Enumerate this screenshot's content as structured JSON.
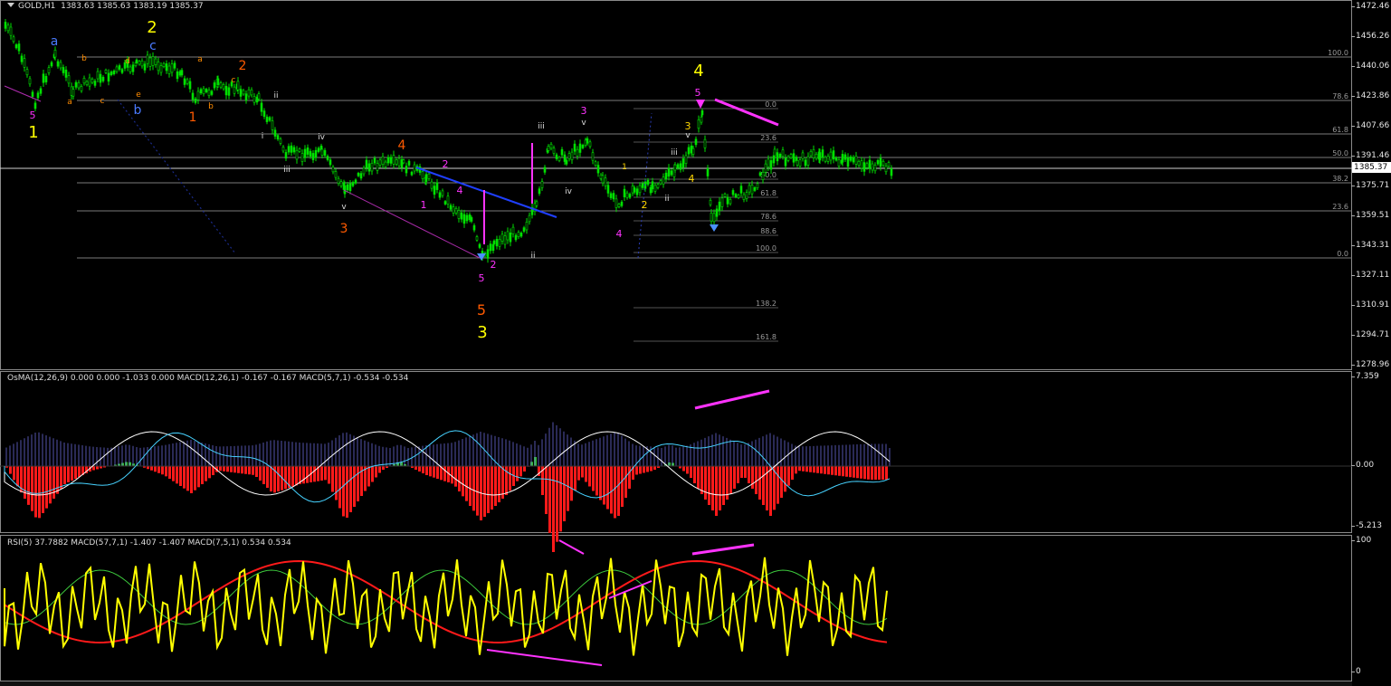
{
  "header": {
    "symbol": "GOLD,H1",
    "ohlc": "1383.63 1385.63 1383.19 1385.37"
  },
  "current_price": "1385.37",
  "price_axis": [
    "1472.46",
    "1456.26",
    "1440.06",
    "1423.86",
    "1407.66",
    "1391.46",
    "1375.71",
    "1359.51",
    "1343.31",
    "1327.11",
    "1310.91",
    "1294.71",
    "1278.96"
  ],
  "osma_panel": {
    "label": "OsMA(12,26,9) 0.000 0.000 -1.033 0.000  MACD(12,26,1) -0.167 -0.167  MACD(5,7,1) -0.534 -0.534",
    "axis": [
      "7.359",
      "0.00",
      "-5.213"
    ]
  },
  "rsi_panel": {
    "label": "RSI(5) 37.7882  MACD(57,7,1) -1.407 -1.407  MACD(7,5,1) 0.534 0.534",
    "axis": [
      "100",
      "0"
    ]
  },
  "fib_left": [
    "100.0",
    "78.6",
    "61.8",
    "50.0",
    "38.2",
    "23.6",
    "0.0"
  ],
  "fib_right": [
    "0.0",
    "23.6",
    "50.0",
    "61.8",
    "78.6",
    "88.6",
    "100.0",
    "138.2",
    "161.8"
  ],
  "wave_labels": {
    "primary": [
      "1",
      "2",
      "3",
      "4"
    ],
    "intermediate": [
      "1",
      "2",
      "3",
      "4",
      "5"
    ],
    "minor": [
      "a",
      "b",
      "c",
      "d",
      "e"
    ],
    "minute": [
      "i",
      "ii",
      "iii",
      "iv",
      "v"
    ]
  },
  "colors": {
    "background": "#000000",
    "candle": "#00e000",
    "wave_yellow": "#ffff00",
    "wave_orange": "#ff5a00",
    "wave_magenta": "#ff33ff",
    "wave_blue": "#4a7bff",
    "fib_line": "#7a7a7a",
    "trend_blue": "#1f3fff",
    "rsi_yellow": "#ffff00",
    "rsi_red": "#ff1a1a",
    "rsi_green": "#3cc83c",
    "macd_hist_up": "#2fc12f",
    "macd_hist_down": "#ff1a1a"
  }
}
